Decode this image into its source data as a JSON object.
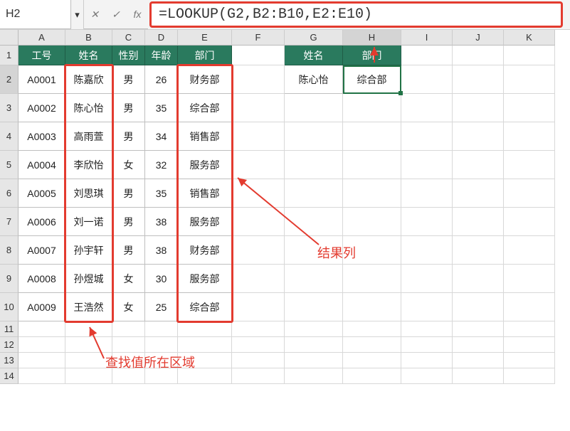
{
  "name_box": "H2",
  "formula": "=LOOKUP(G2,B2:B10,E2:E10)",
  "chart_data": {
    "type": "table",
    "title": "",
    "columns": [
      "工号",
      "姓名",
      "性别",
      "年龄",
      "部门"
    ],
    "rows": [
      [
        "A0001",
        "陈嘉欣",
        "男",
        "26",
        "财务部"
      ],
      [
        "A0002",
        "陈心怡",
        "男",
        "35",
        "综合部"
      ],
      [
        "A0003",
        "高雨萱",
        "男",
        "34",
        "销售部"
      ],
      [
        "A0004",
        "李欣怡",
        "女",
        "32",
        "服务部"
      ],
      [
        "A0005",
        "刘思琪",
        "男",
        "35",
        "销售部"
      ],
      [
        "A0006",
        "刘一诺",
        "男",
        "38",
        "服务部"
      ],
      [
        "A0007",
        "孙宇轩",
        "男",
        "38",
        "财务部"
      ],
      [
        "A0008",
        "孙煜城",
        "女",
        "30",
        "服务部"
      ],
      [
        "A0009",
        "王浩然",
        "女",
        "25",
        "综合部"
      ]
    ],
    "lookup": {
      "headers": [
        "姓名",
        "部门"
      ],
      "row": [
        "陈心怡",
        "综合部"
      ]
    }
  },
  "col_labels": [
    "A",
    "B",
    "C",
    "D",
    "E",
    "F",
    "G",
    "H",
    "I",
    "J",
    "K"
  ],
  "row_labels": [
    "1",
    "2",
    "3",
    "4",
    "5",
    "6",
    "7",
    "8",
    "9",
    "10",
    "11",
    "12",
    "13",
    "14"
  ],
  "annotations": {
    "lookup_area": "查找值所在区域",
    "result_col": "结果列"
  },
  "fx_buttons": {
    "cancel": "✕",
    "enter": "✓",
    "fx": "fx"
  },
  "dropdown_glyph": "▾"
}
